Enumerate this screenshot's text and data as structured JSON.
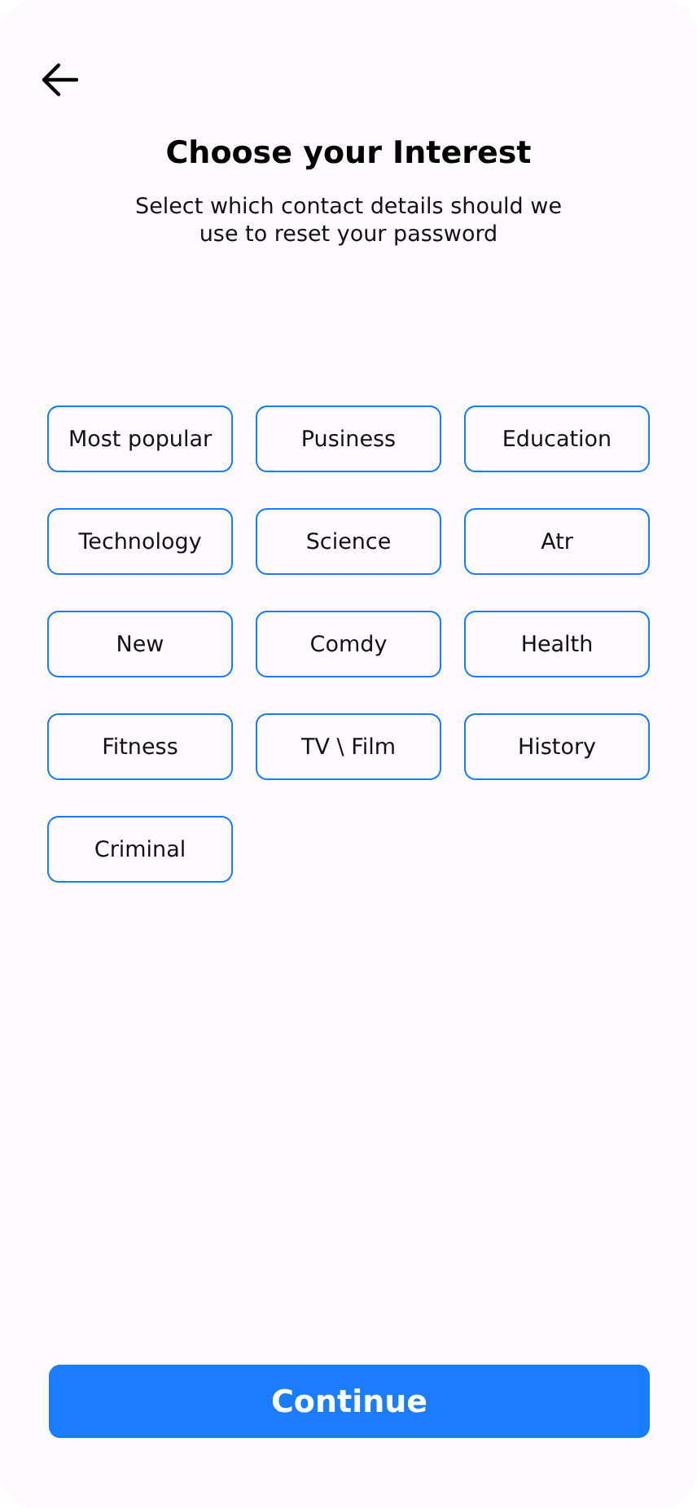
{
  "title": "Choose your Interest",
  "subtitle": "Select which contact details should we use to reset your password",
  "interests": [
    {
      "label": "Most popular"
    },
    {
      "label": "Pusiness"
    },
    {
      "label": "Education"
    },
    {
      "label": "Technology"
    },
    {
      "label": "Science"
    },
    {
      "label": "Atr"
    },
    {
      "label": "New"
    },
    {
      "label": "Comdy"
    },
    {
      "label": "Health"
    },
    {
      "label": "Fitness"
    },
    {
      "label": "TV \\ Film"
    },
    {
      "label": "History"
    },
    {
      "label": "Criminal"
    }
  ],
  "continue_button": "Continue"
}
